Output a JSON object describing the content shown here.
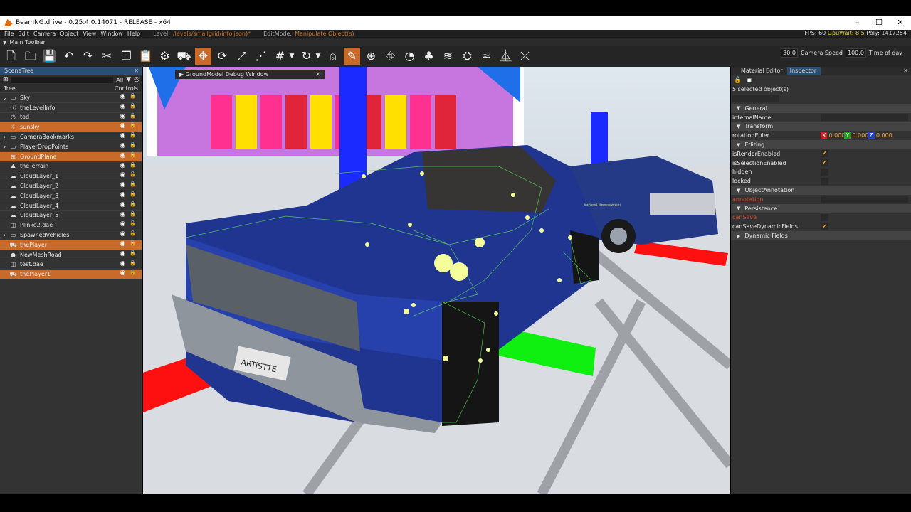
{
  "window": {
    "title": "BeamNG.drive - 0.25.4.0.14071 - RELEASE - x64",
    "controls": [
      "–",
      "☐",
      "✕"
    ]
  },
  "menubar": {
    "items": [
      "File",
      "Edit",
      "Camera",
      "Object",
      "View",
      "Window",
      "Help"
    ],
    "level_label": "Level:",
    "level_value": "/levels/smallgrid/info.json)*",
    "editmode_label": "EditMode:",
    "editmode_value": "Manipulate Object(s)",
    "fps": "FPS: 60",
    "gpuwait": "GpuWait: 8.5",
    "poly": "Poly: 1417254"
  },
  "toolbar": {
    "header": "Main Toolbar",
    "camera_speed_value": "30.0",
    "camera_speed_label": "Camera Speed",
    "time_of_day_value": "100.0",
    "time_of_day_label": "Time of day"
  },
  "scenetree": {
    "title": "SceneTree",
    "filter": "All",
    "col_tree": "Tree",
    "col_controls": "Controls",
    "items": [
      {
        "label": "Sky",
        "icon": "folder-icon",
        "expand": "▾",
        "selected": false
      },
      {
        "label": "theLevelInfo",
        "icon": "info-icon",
        "expand": "",
        "selected": false
      },
      {
        "label": "tod",
        "icon": "clock-icon",
        "expand": "",
        "selected": false
      },
      {
        "label": "sunsky",
        "icon": "sun-icon",
        "expand": "",
        "selected": true
      },
      {
        "label": "CameraBookmarks",
        "icon": "folder-icon",
        "expand": "▸",
        "selected": false
      },
      {
        "label": "PlayerDropPoints",
        "icon": "folder-icon",
        "expand": "▸",
        "selected": false
      },
      {
        "label": "GroundPlane",
        "icon": "grid-icon",
        "expand": "",
        "selected": true
      },
      {
        "label": "theTerrain",
        "icon": "terrain-icon",
        "expand": "",
        "selected": false
      },
      {
        "label": "CloudLayer_1",
        "icon": "cloud-icon",
        "expand": "",
        "selected": false
      },
      {
        "label": "CloudLayer_2",
        "icon": "cloud-icon",
        "expand": "",
        "selected": false
      },
      {
        "label": "CloudLayer_3",
        "icon": "cloud-icon",
        "expand": "",
        "selected": false
      },
      {
        "label": "CloudLayer_4",
        "icon": "cloud-icon",
        "expand": "",
        "selected": false
      },
      {
        "label": "CloudLayer_5",
        "icon": "cloud-icon",
        "expand": "",
        "selected": false
      },
      {
        "label": "Plinko2.dae",
        "icon": "mesh-icon",
        "expand": "",
        "selected": false
      },
      {
        "label": "SpawnedVehicles",
        "icon": "folder-icon",
        "expand": "▸",
        "selected": false
      },
      {
        "label": "thePlayer",
        "icon": "car-icon",
        "expand": "",
        "selected": true
      },
      {
        "label": "NewMeshRoad",
        "icon": "road-icon",
        "expand": "",
        "selected": false
      },
      {
        "label": "test.dae",
        "icon": "mesh-icon",
        "expand": "",
        "selected": false
      },
      {
        "label": "thePlayer1",
        "icon": "car-icon",
        "expand": "",
        "selected": true
      }
    ]
  },
  "viewport": {
    "debug_window_title": "GroundModel Debug Window",
    "plate_text": "ARTiSTTE",
    "vehicle_tag": "thePlayer1 (Beamng/Vehicle)"
  },
  "inspector": {
    "tab_material": "Material Editor",
    "tab_inspector": "Inspector",
    "selection_count": "5 selected object(s)",
    "rows": [
      {
        "kind": "group",
        "label": "General"
      },
      {
        "kind": "field",
        "label": "internalName"
      },
      {
        "kind": "group",
        "label": "Transform"
      },
      {
        "kind": "xyz",
        "label": "rotationEuler",
        "x": "0.000",
        "y": "0.000",
        "z": "0.000"
      },
      {
        "kind": "group",
        "label": "Editing"
      },
      {
        "kind": "check",
        "label": "isRenderEnabled",
        "checked": true
      },
      {
        "kind": "check",
        "label": "isSelectionEnabled",
        "checked": true
      },
      {
        "kind": "check",
        "label": "hidden",
        "checked": false
      },
      {
        "kind": "check",
        "label": "locked",
        "checked": false
      },
      {
        "kind": "group",
        "label": "ObjectAnnotation"
      },
      {
        "kind": "field",
        "label": "annotation",
        "red": true
      },
      {
        "kind": "group",
        "label": "Persistence"
      },
      {
        "kind": "check",
        "label": "canSave",
        "checked": false,
        "red": true
      },
      {
        "kind": "check",
        "label": "canSaveDynamicFields",
        "checked": true
      },
      {
        "kind": "group",
        "label": "Dynamic Fields",
        "collapsed": true
      }
    ]
  }
}
